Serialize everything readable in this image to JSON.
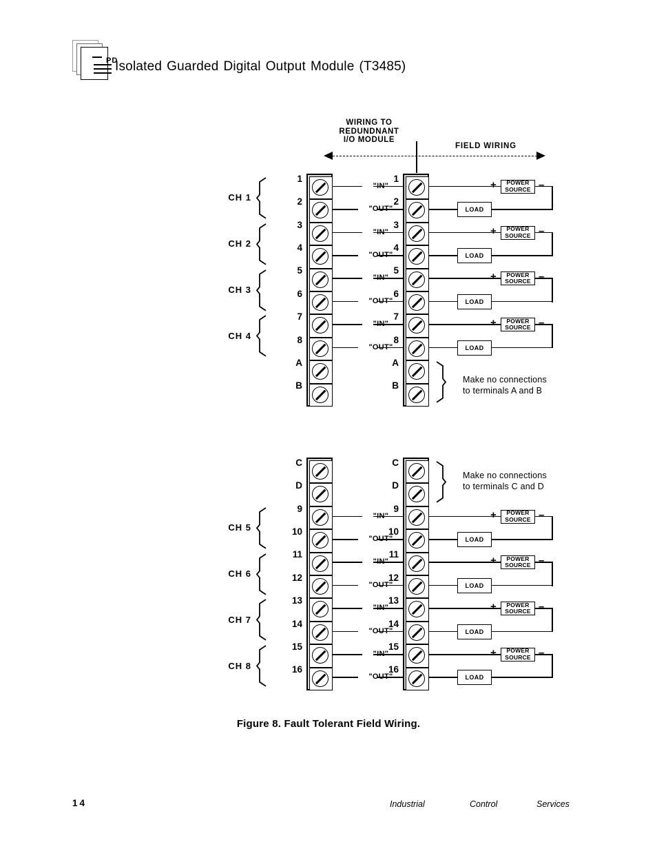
{
  "document": {
    "title": "Isolated  Guarded  Digital  Output  Module (T3485)",
    "title_words": [
      "Isolated",
      "Guarded",
      "Digital",
      "Output",
      "Module",
      "(T3485)"
    ],
    "icon_label": "PD",
    "caption": "Figure 8.  Fault Tolerant Field Wiring.",
    "page_number": "14",
    "footer": {
      "word1": "Industrial",
      "word2": "Control",
      "word3": "Services"
    }
  },
  "diagram_header": {
    "left_line1": "WIRING  TO",
    "left_line2": "REDUNDNANT",
    "left_line3": "I/O  MODULE",
    "right_label": "FIELD  WIRING"
  },
  "labels": {
    "in": "\"IN\"",
    "out": "\"OUT\"",
    "power_source_line1": "POWER",
    "power_source_line2": "SOURCE",
    "load": "LOAD",
    "plus": "+",
    "minus": "–"
  },
  "notes": {
    "ab_line1": "Make  no  connections",
    "ab_line2": "to  terminals  A  and  B",
    "cd_line1": "Make  no  connections",
    "cd_line2": "to  terminals  C  and  D"
  },
  "diagram_top": {
    "channels": [
      {
        "label": "CH  1",
        "terminals": [
          "1",
          "2"
        ]
      },
      {
        "label": "CH  2",
        "terminals": [
          "3",
          "4"
        ]
      },
      {
        "label": "CH  3",
        "terminals": [
          "5",
          "6"
        ]
      },
      {
        "label": "CH  4",
        "terminals": [
          "7",
          "8"
        ]
      }
    ],
    "extra_terminals": [
      "A",
      "B"
    ],
    "all_terminals": [
      "1",
      "2",
      "3",
      "4",
      "5",
      "6",
      "7",
      "8",
      "A",
      "B"
    ]
  },
  "diagram_bottom": {
    "lead_terminals": [
      "C",
      "D"
    ],
    "channels": [
      {
        "label": "CH  5",
        "terminals": [
          "9",
          "10"
        ]
      },
      {
        "label": "CH  6",
        "terminals": [
          "11",
          "12"
        ]
      },
      {
        "label": "CH  7",
        "terminals": [
          "13",
          "14"
        ]
      },
      {
        "label": "CH  8",
        "terminals": [
          "15",
          "16"
        ]
      }
    ],
    "all_terminals": [
      "C",
      "D",
      "9",
      "10",
      "11",
      "12",
      "13",
      "14",
      "15",
      "16"
    ]
  },
  "colors": {
    "ink": "#000000",
    "block_fill": "#d8d8d8",
    "paper": "#ffffff"
  }
}
